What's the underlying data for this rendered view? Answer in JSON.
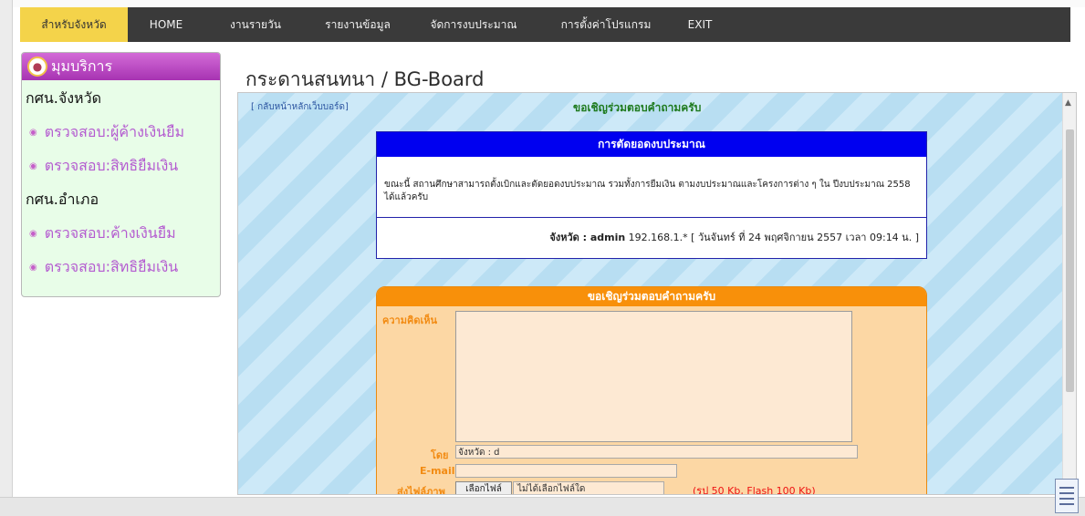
{
  "nav": {
    "items": [
      "สำหรับจังหวัด",
      "HOME",
      "งานรายวัน",
      "รายงานข้อมูล",
      "จัดการงบประมาณ",
      "การตั้งค่าโปรแกรม",
      "EXIT"
    ]
  },
  "sidebar": {
    "title": "มุมบริการ",
    "groups": [
      {
        "label": "กศน.จังหวัด",
        "links": [
          "ตรวจสอบ:ผู้ค้างเงินยืม",
          "ตรวจสอบ:สิทธิยืมเงิน"
        ]
      },
      {
        "label": "กศน.อำเภอ",
        "links": [
          "ตรวจสอบ:ค้างเงินยืม",
          "ตรวจสอบ:สิทธิยืมเงิน"
        ]
      }
    ]
  },
  "page": {
    "title": "กระดานสนทนา / BG-Board"
  },
  "board": {
    "back_link": "[ กลับหน้าหลักเว็บบอร์ด]",
    "header": "ขอเชิญร่วมตอบคำถามครับ"
  },
  "post": {
    "title": "การตัดยอดงบประมาณ",
    "body": "ขณะนี้ สถานศึกษาสามารถตั้งเบิกและตัดยอดงบประมาณ รวมทั้งการยืมเงิน ตามงบประมาณและโครงการต่าง ๆ ใน ปีงบประมาณ 2558 ได้แล้วครับ",
    "author_label": "จังหวัด : admin",
    "meta": " 192.168.1.* [ วันจันทร์ ที่ 24 พฤศจิกายน 2557 เวลา 09:14 น. ]"
  },
  "reply": {
    "title": "ขอเชิญร่วมตอบคำถามครับ",
    "comment_label": "ความคิดเห็น",
    "by_label": "โดย",
    "by_value": "จังหวัด : d",
    "email_label": "E-mail",
    "image_label": "ส่งไฟล์ภาพ",
    "file_button": "เลือกไฟล์",
    "file_name": "ไม่ได้เลือกไฟล์ใด",
    "file_note": "(รป 50 Kb, Flash 100 Kb)"
  }
}
